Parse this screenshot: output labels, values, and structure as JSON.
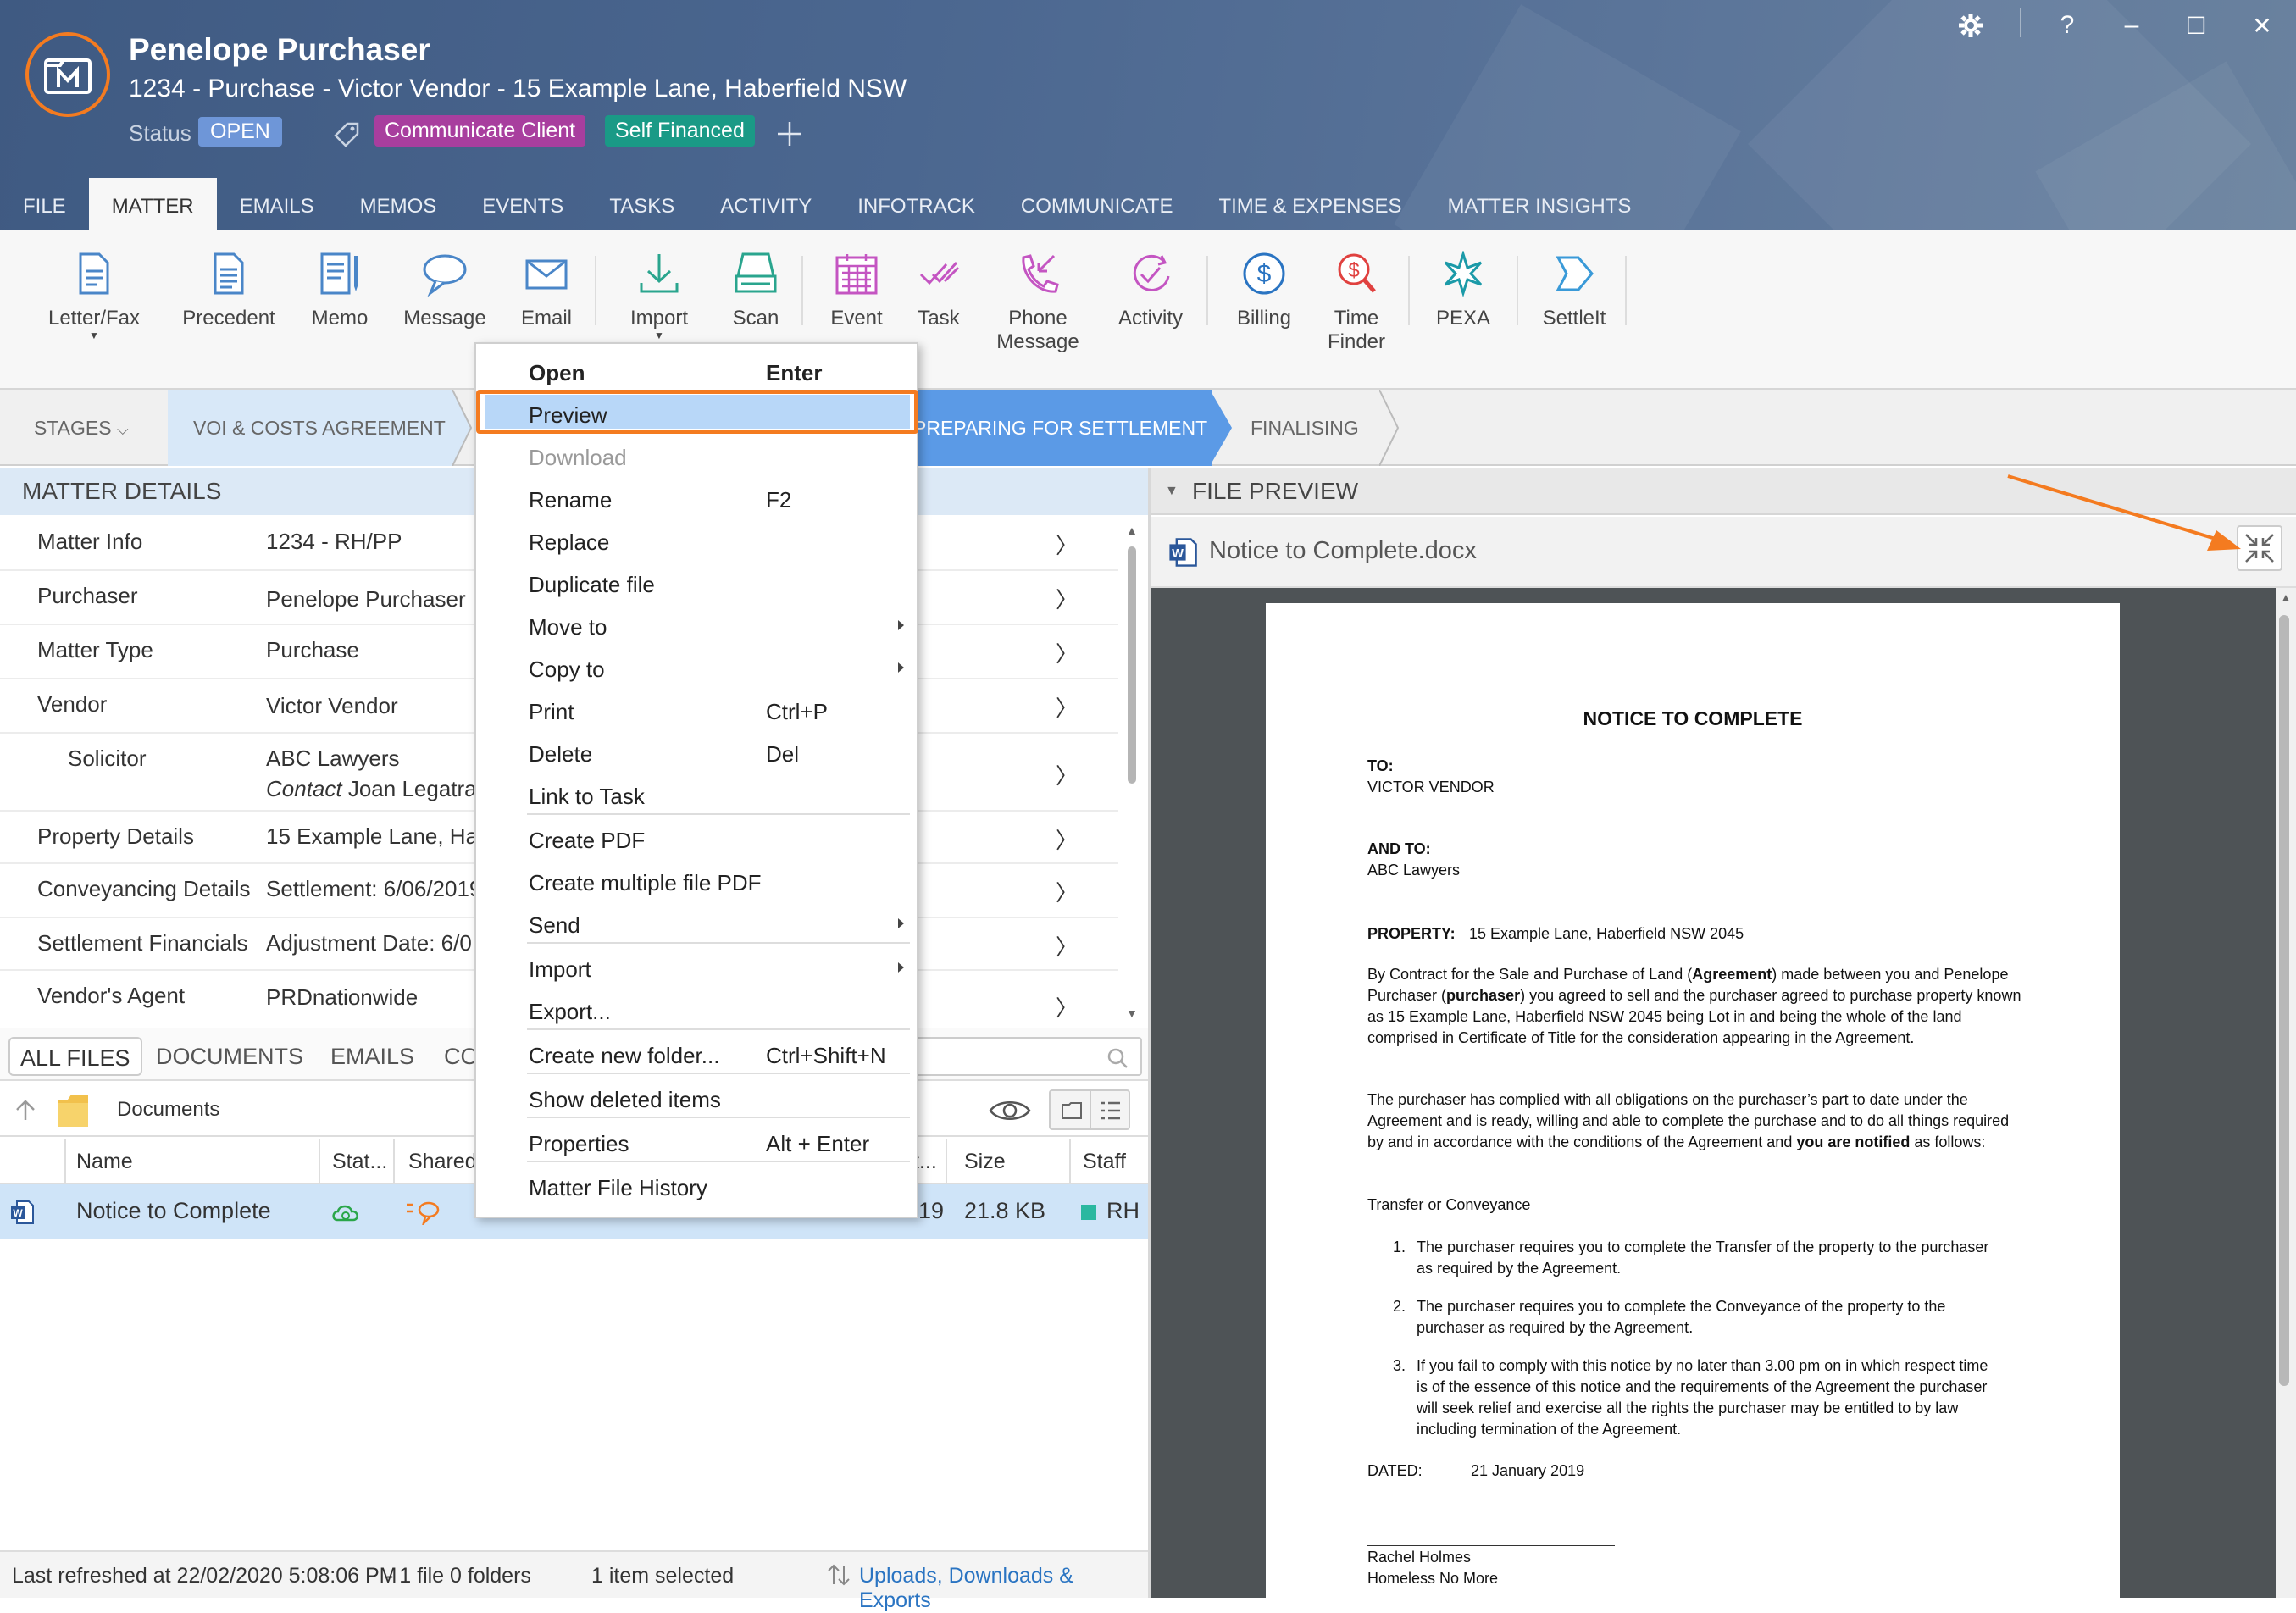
{
  "window": {
    "settings_icon": "gear-icon",
    "help": "?",
    "minimize": "–",
    "maximize": "☐",
    "close": "✕"
  },
  "matter": {
    "client_name": "Penelope Purchaser",
    "title": "1234 - Purchase - Victor Vendor - 15 Example Lane, Haberfield NSW",
    "status_label": "Status",
    "status": "OPEN",
    "tags": [
      {
        "label": "Communicate Client",
        "color": "#a83e9e"
      },
      {
        "label": "Self Financed",
        "color": "#1a9a86"
      }
    ]
  },
  "tabs": [
    "FILE",
    "MATTER",
    "EMAILS",
    "MEMOS",
    "EVENTS",
    "TASKS",
    "ACTIVITY",
    "INFOTRACK",
    "COMMUNICATE",
    "TIME & EXPENSES",
    "MATTER INSIGHTS"
  ],
  "active_tab": "MATTER",
  "ribbon": [
    "Letter/Fax",
    "Precedent",
    "Memo",
    "Message",
    "Email",
    "Import",
    "Scan",
    "Event",
    "Task",
    "Phone\nMessage",
    "Activity",
    "Billing",
    "Time\nFinder",
    "PEXA",
    "SettleIt"
  ],
  "stages": {
    "label": "STAGES",
    "items": [
      "VOI & COSTS AGREEMENT",
      "PREPARING FOR SETTLEMENT",
      "FINALISING"
    ]
  },
  "matter_details": {
    "header": "MATTER DETAILS",
    "rows": [
      {
        "label": "Matter Info",
        "value": "1234 - RH/PP"
      },
      {
        "label": "Purchaser",
        "value": "Penelope Purchaser"
      },
      {
        "label": "Matter Type",
        "value": "Purchase"
      },
      {
        "label": "Vendor",
        "value": "Victor Vendor"
      },
      {
        "label": "Solicitor",
        "value": "ABC Lawyers",
        "contact_label": "Contact",
        "contact": "Joan Legatra"
      },
      {
        "label": "Property Details",
        "value": "15 Example Lane, Hab"
      },
      {
        "label": "Conveyancing Details",
        "value": "Settlement: 6/06/2019"
      },
      {
        "label": "Settlement Financials",
        "value": "Adjustment Date: 6/0"
      },
      {
        "label": "Vendor's Agent",
        "value": "PRDnationwide"
      }
    ]
  },
  "files": {
    "tabs": [
      "ALL FILES",
      "DOCUMENTS",
      "EMAILS",
      "CO"
    ],
    "path": "Documents",
    "columns": {
      "name": "Name",
      "status": "Stat...",
      "shared": "Shared",
      "date": "t...",
      "size": "Size",
      "staff": "Staff"
    },
    "rows": [
      {
        "name": "Notice to Complete",
        "date": "19",
        "size": "21.8 KB",
        "staff": "RH"
      }
    ]
  },
  "status_bar": {
    "refreshed": "Last refreshed at 22/02/2020 5:08:06 PM",
    "counts": "-  1 file  0 folders",
    "selection": "1 item selected",
    "link": "Uploads, Downloads & Exports"
  },
  "context_menu": [
    {
      "label": "Open",
      "shortcut": "Enter",
      "bold": true
    },
    {
      "label": "Preview",
      "shortcut": "",
      "highlight": true
    },
    {
      "label": "Download",
      "shortcut": "",
      "disabled": true
    },
    {
      "label": "Rename",
      "shortcut": "F2"
    },
    {
      "label": "Replace",
      "shortcut": ""
    },
    {
      "label": "Duplicate file",
      "shortcut": ""
    },
    {
      "label": "Move to",
      "shortcut": "",
      "submenu": true
    },
    {
      "label": "Copy to",
      "shortcut": "",
      "submenu": true
    },
    {
      "label": "Print",
      "shortcut": "Ctrl+P"
    },
    {
      "label": "Delete",
      "shortcut": "Del"
    },
    {
      "label": "Link to Task",
      "shortcut": ""
    },
    {
      "label": "Create PDF",
      "shortcut": ""
    },
    {
      "label": "Create multiple file PDF",
      "shortcut": ""
    },
    {
      "label": "Send",
      "shortcut": "",
      "submenu": true
    },
    {
      "label": "Import",
      "shortcut": "",
      "submenu": true
    },
    {
      "label": "Export...",
      "shortcut": ""
    },
    {
      "label": "Create new folder...",
      "shortcut": "Ctrl+Shift+N"
    },
    {
      "label": "Show deleted items",
      "shortcut": ""
    },
    {
      "label": "Properties",
      "shortcut": "Alt + Enter"
    },
    {
      "label": "Matter File History",
      "shortcut": ""
    }
  ],
  "preview": {
    "header": "FILE PREVIEW",
    "filename": "Notice to Complete.docx",
    "doc": {
      "title": "NOTICE TO COMPLETE",
      "to_label": "TO:",
      "to": "VICTOR VENDOR",
      "and_to_label": "AND TO:",
      "and_to": "ABC Lawyers",
      "property_label": "PROPERTY:",
      "property": "15 Example Lane, Haberfield NSW 2045",
      "para1": "By Contract for the Sale and Purchase of Land (Agreement) made between you and Penelope Purchaser (purchaser) you agreed to sell and the purchaser agreed to purchase property known as 15 Example Lane, Haberfield NSW 2045 being Lot  in   and being the whole of the land comprised in Certificate of Title  for the consideration appearing in the Agreement.",
      "para2": "The purchaser has complied with all obligations on the purchaser’s part to date under the Agreement and is ready, willing and able to complete the purchase and to do all things required by and in accordance with the conditions of the Agreement and you are notified as follows:",
      "section": "Transfer or Conveyance",
      "items": [
        "The purchaser requires you to complete the Transfer of the property to the purchaser as required by the Agreement.",
        "The purchaser requires you to complete the Conveyance of the property to the purchaser as required by the Agreement.",
        "If you fail to comply with this notice by no later than 3.00 pm on  in which respect time is of the essence of this notice and the requirements of the Agreement the purchaser will seek relief and exercise all the rights the purchaser may be entitled to by law including termination of the Agreement."
      ],
      "dated_label": "DATED:",
      "dated": "21 January 2019",
      "signer": "Rachel Holmes",
      "company": "Homeless No More"
    }
  }
}
